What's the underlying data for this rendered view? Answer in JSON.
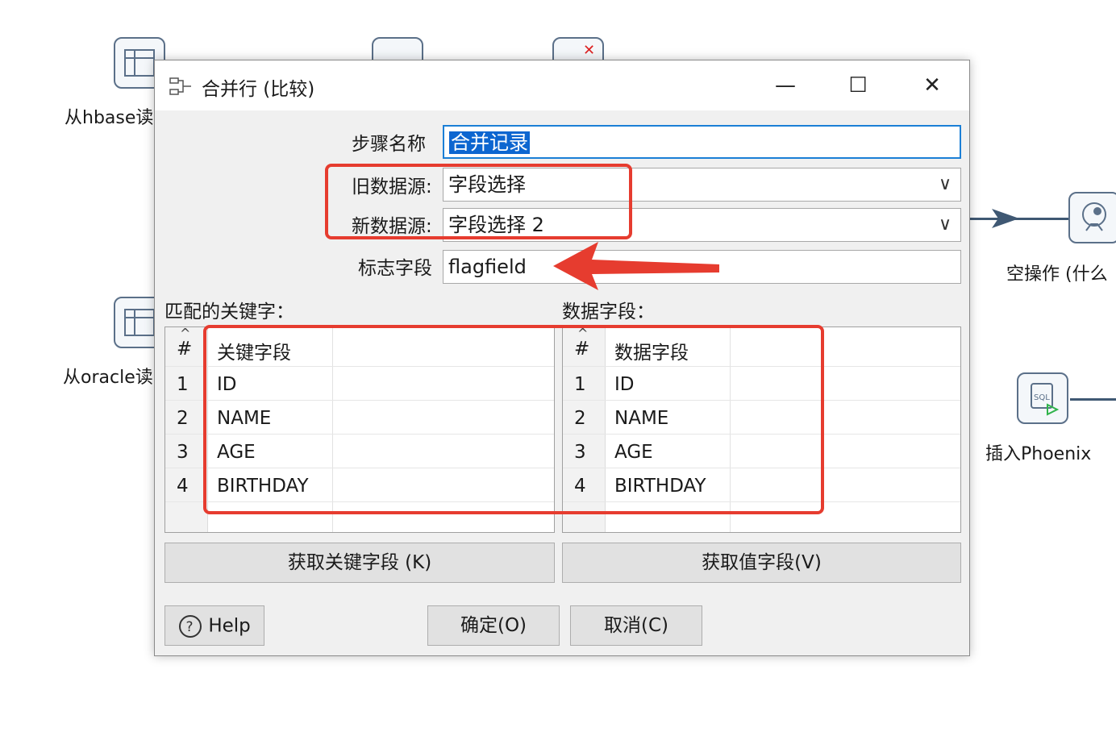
{
  "canvas": {
    "node_hbase": "从hbase读",
    "node_oracle": "从oracle读",
    "node_dummy": "空操作 (什么",
    "node_phoenix": "插入Phoenix"
  },
  "dialog": {
    "title": "合并行 (比较)",
    "minimize_glyph": "—",
    "maximize_glyph": "☐",
    "close_glyph": "✕",
    "step_name_label": "步骤名称",
    "step_name_value": "合并记录",
    "old_source_label": "旧数据源:",
    "old_source_value": "字段选择",
    "new_source_label": "新数据源:",
    "new_source_value": "字段选择 2",
    "flag_field_label": "标志字段",
    "flag_field_value": "flagfield",
    "combo_arrow_glyph": "∨",
    "keys_section_label": "匹配的关键字：",
    "values_section_label": "数据字段：",
    "keys_table": {
      "num_header": "#",
      "col_header": "关键字段",
      "rows": [
        {
          "num": "1",
          "value": "ID"
        },
        {
          "num": "2",
          "value": "NAME"
        },
        {
          "num": "3",
          "value": "AGE"
        },
        {
          "num": "4",
          "value": "BIRTHDAY"
        }
      ]
    },
    "values_table": {
      "num_header": "#",
      "col_header": "数据字段",
      "rows": [
        {
          "num": "1",
          "value": "ID"
        },
        {
          "num": "2",
          "value": "NAME"
        },
        {
          "num": "3",
          "value": "AGE"
        },
        {
          "num": "4",
          "value": "BIRTHDAY"
        }
      ]
    },
    "get_keys_button": "获取关键字段 (K)",
    "get_values_button": "获取值字段(V)",
    "help_button": "Help",
    "ok_button": "确定(O)",
    "cancel_button": "取消(C)"
  },
  "colors": {
    "annotation_red": "#e63c2f",
    "selection_blue": "#0d66d0",
    "focus_blue": "#1b7fd6"
  }
}
